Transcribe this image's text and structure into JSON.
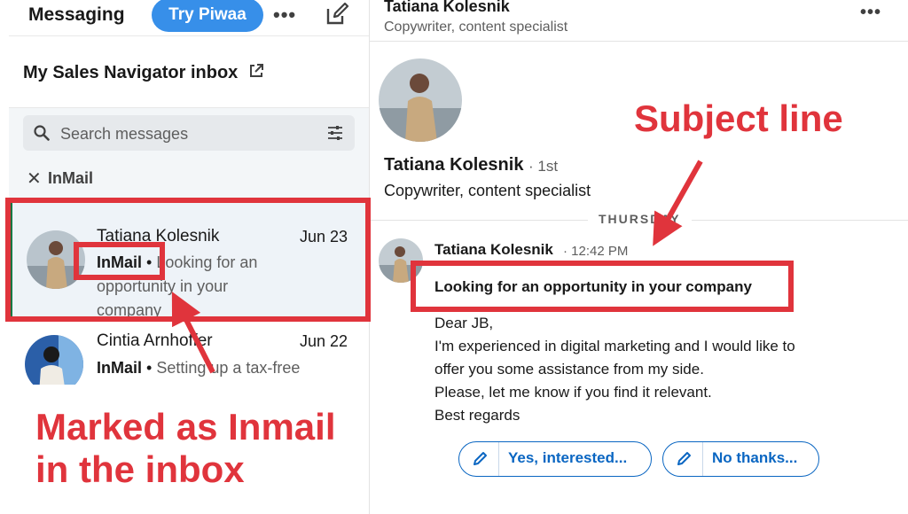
{
  "left_header": {
    "title": "Messaging",
    "try_button": "Try Piwaa",
    "more_icon": "more-horizontal-icon",
    "compose_icon": "compose-icon"
  },
  "inbox": {
    "title": "My Sales Navigator inbox",
    "external_icon": "external-link-icon"
  },
  "search": {
    "placeholder": "Search messages"
  },
  "filter": {
    "label": "InMail"
  },
  "conversations": [
    {
      "name": "Tatiana Kolesnik",
      "date": "Jun 23",
      "tag": "InMail",
      "snippet": "Looking for an opportunity in your company",
      "selected": true
    },
    {
      "name": "Cintia Arnhoffer",
      "date": "Jun 22",
      "tag": "InMail",
      "snippet": "Setting up a tax-free",
      "selected": false
    }
  ],
  "right_header": {
    "name": "Tatiana Kolesnik",
    "subtitle": "Copywriter, content specialist"
  },
  "profile": {
    "name": "Tatiana Kolesnik",
    "degree": "· 1st",
    "headline": "Copywriter, content specialist"
  },
  "thread": {
    "day_label": "THURSDAY",
    "sender": "Tatiana Kolesnik",
    "time": "· 12:42 PM",
    "subject": "Looking for an opportunity in your company",
    "body": [
      "Dear JB,",
      "I'm experienced in digital marketing and I would like to",
      "offer you some assistance from my side.",
      "Please, let me know if you find it relevant.",
      "Best regards"
    ]
  },
  "replies": {
    "yes": "Yes, interested...",
    "no": "No thanks..."
  },
  "annotations": {
    "inbox_note": "Marked as Inmail in the inbox",
    "subject_note": "Subject line"
  },
  "colors": {
    "annotation_red": "#e0343c",
    "linkedin_blue": "#0a66c2",
    "try_button_blue": "#378fe9",
    "selected_bg": "#eef3f8",
    "selected_border": "#057642"
  }
}
